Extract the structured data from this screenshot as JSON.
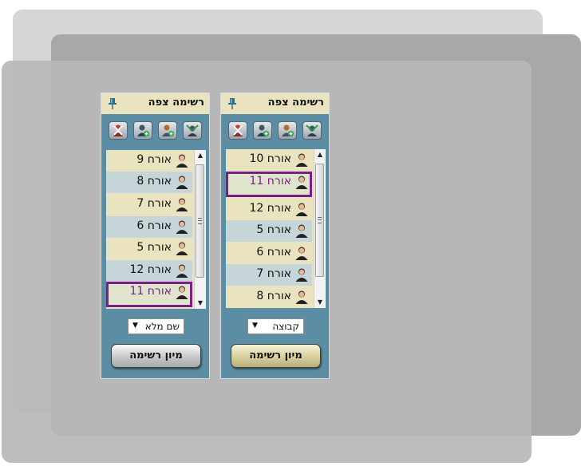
{
  "panels": [
    {
      "title": "רשימה צפה",
      "items": [
        "אורח 9",
        "אורח 8",
        "אורח 7",
        "אורח 6",
        "אורח 5",
        "אורח 12",
        "אורח 11"
      ],
      "sort_field": "שם מלא",
      "sort_button": "מיון רשימה"
    },
    {
      "title": "רשימה צפה",
      "items": [
        "אורח 10",
        "אורח 11",
        "אורח 12",
        "אורח 5",
        "אורח 6",
        "אורח 7",
        "אורח 8"
      ],
      "sort_field": "קבוצה",
      "sort_button": "מיון רשימה"
    }
  ],
  "icons": {
    "header": "pin-icon",
    "toolbar": [
      "remove-user-icon",
      "add-user-icon",
      "add-guest-icon",
      "filter-users-icon"
    ],
    "list_item": "person-icon"
  },
  "colors": {
    "panel_bg": "#5b8ea5",
    "header_bg": "#e9e3bf",
    "row_light": "#e9e3bf",
    "row_alt": "#c5d5d8",
    "selected_border": "#7a1f86"
  }
}
